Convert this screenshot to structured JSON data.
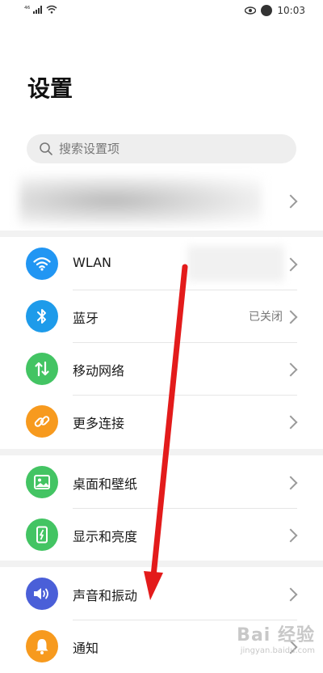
{
  "status_bar": {
    "signal_text": "⁴⁶",
    "time": "10:03"
  },
  "page_title": "设置",
  "search": {
    "placeholder": "搜索设置项"
  },
  "groups": [
    {
      "items": [
        {
          "label": "WLAN",
          "value": "",
          "icon": "wifi-icon",
          "color": "#2196f3"
        },
        {
          "label": "蓝牙",
          "value": "已关闭",
          "icon": "bluetooth-icon",
          "color": "#1e9bea"
        },
        {
          "label": "移动网络",
          "value": "",
          "icon": "mobile-data-icon",
          "color": "#43c463"
        },
        {
          "label": "更多连接",
          "value": "",
          "icon": "link-icon",
          "color": "#f79a1e"
        }
      ]
    },
    {
      "items": [
        {
          "label": "桌面和壁纸",
          "value": "",
          "icon": "wallpaper-icon",
          "color": "#43c463"
        },
        {
          "label": "显示和亮度",
          "value": "",
          "icon": "display-icon",
          "color": "#43c463"
        }
      ]
    },
    {
      "items": [
        {
          "label": "声音和振动",
          "value": "",
          "icon": "sound-icon",
          "color": "#4a5fd8"
        },
        {
          "label": "通知",
          "value": "",
          "icon": "bell-icon",
          "color": "#f79a1e"
        }
      ]
    }
  ],
  "watermark": {
    "main": "Bai 经验",
    "sub": "jingyan.baidu.com"
  },
  "annotation_color": "#e31b1b"
}
